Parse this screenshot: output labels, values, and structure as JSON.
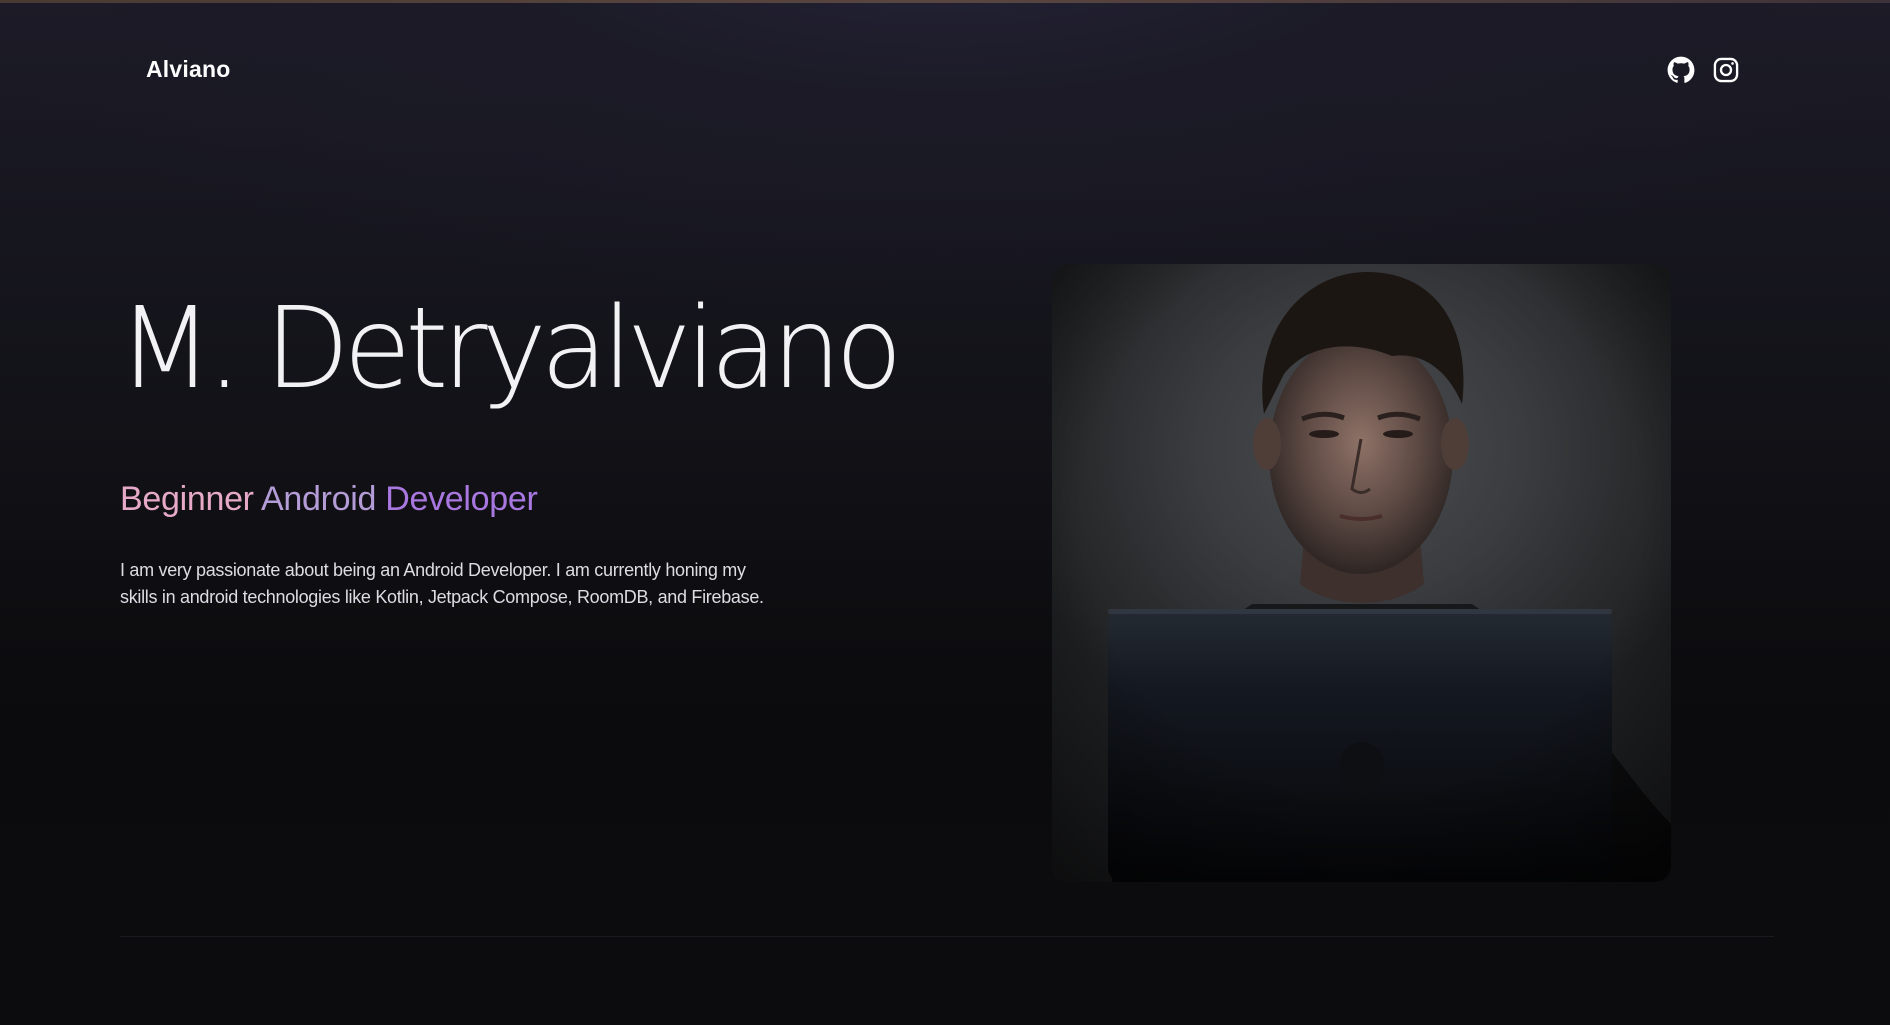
{
  "header": {
    "brand": "Alviano",
    "social": [
      {
        "name": "github",
        "icon": "github-icon"
      },
      {
        "name": "instagram",
        "icon": "instagram-icon"
      }
    ]
  },
  "hero": {
    "name": "M. Detryalviano",
    "role_words": [
      "Beginner",
      "Android",
      "Developer"
    ],
    "bio": "I am very passionate about being an Android Developer. I am currently honing my skills in android technologies like Kotlin, Jetpack Compose, RoomDB, and Firebase.",
    "photo": {
      "alt": "Portrait of a young man lit by a laptop screen in a dark room"
    }
  },
  "colors": {
    "background": "#0c0c0e",
    "role_gradient": [
      "#e6a9c8",
      "#b49cd7",
      "#a877e0"
    ],
    "text": "#f2f2f4"
  }
}
